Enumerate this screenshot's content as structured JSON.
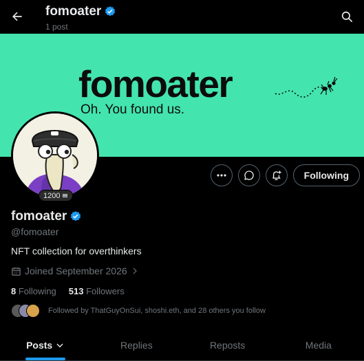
{
  "header": {
    "title": "fomoater",
    "post_count": "1 post"
  },
  "banner": {
    "logo_text": "fomoater",
    "tagline": "Oh. You found us.",
    "background_color": "#43e4ae"
  },
  "avatar": {
    "badge": "1200"
  },
  "actions": {
    "following_label": "Following"
  },
  "profile": {
    "name": "fomoater",
    "handle": "@fomoater",
    "bio": "NFT collection for overthinkers",
    "joined": "Joined September 2026",
    "following_count": "8",
    "following_label": "Following",
    "followers_count": "513",
    "followers_label": "Followers",
    "followed_by": "Followed by ThatGuyOnSui, shoshi.eth, and 28 others you follow"
  },
  "tabs": [
    {
      "label": "Posts",
      "active": true
    },
    {
      "label": "Replies",
      "active": false
    },
    {
      "label": "Reposts",
      "active": false
    },
    {
      "label": "Media",
      "active": false
    }
  ],
  "colors": {
    "accent": "#1d9bf0",
    "verified": "#1d9bf0",
    "banner": "#43e4ae"
  }
}
